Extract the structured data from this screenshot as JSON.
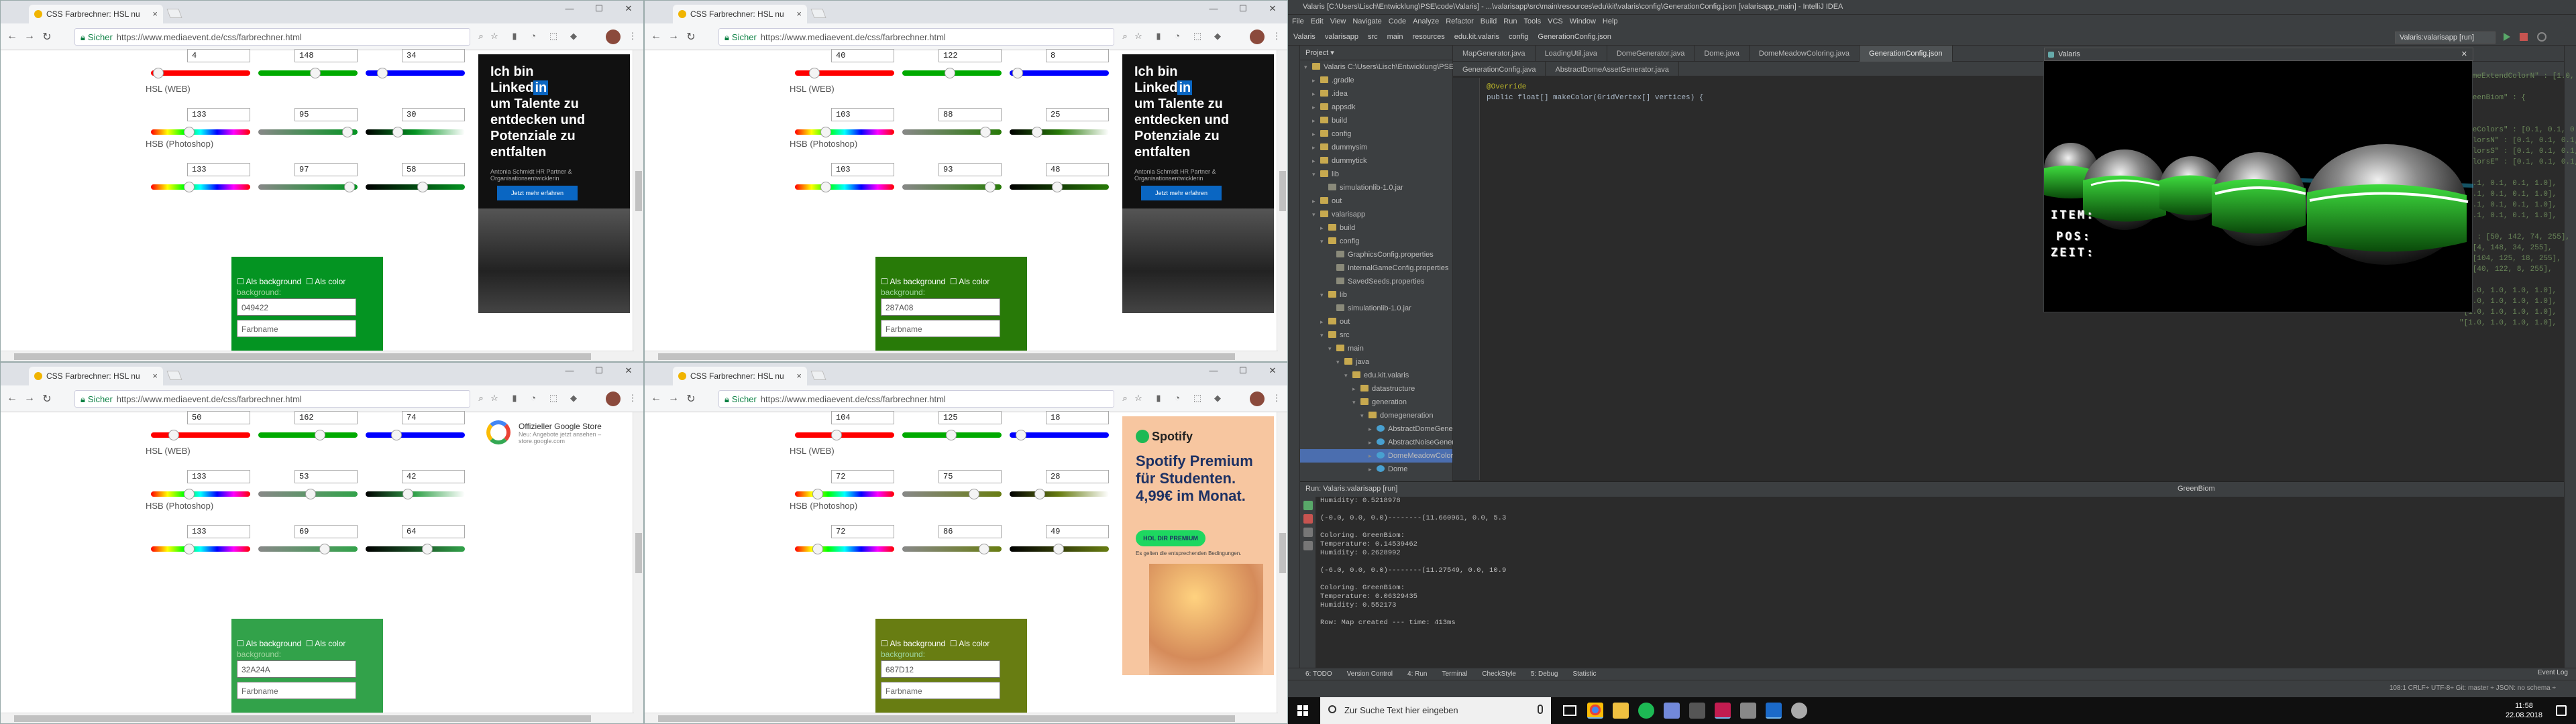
{
  "browser": {
    "tab_title": "CSS Farbrechner: HSL nu",
    "secure_label": "Sicher",
    "url": "https://www.mediaevent.de/css/farbrechner.html",
    "close_tab": "×",
    "win_min": "—",
    "win_max": "☐",
    "win_close": "✕"
  },
  "labels": {
    "hsl": "HSL (WEB)",
    "hsb": "HSB (Photoshop)",
    "as_background": "Als background",
    "as_color": "Als color",
    "background_hint": "background:",
    "colorname_placeholder": "Farbname"
  },
  "panels": [
    {
      "rgb": [
        "4",
        "148",
        "34"
      ],
      "hsl": [
        "133",
        "95",
        "30"
      ],
      "hsb": [
        "133",
        "97",
        "58"
      ],
      "hex": "049422",
      "box_color": "#049422",
      "rgb_pos": [
        0.02,
        0.58,
        0.13
      ],
      "hsl_pos": [
        0.37,
        0.95,
        0.3
      ],
      "hsb_pos": [
        0.37,
        0.97,
        0.58
      ],
      "ad": "linkedin"
    },
    {
      "rgb": [
        "40",
        "122",
        "8"
      ],
      "hsl": [
        "103",
        "88",
        "25"
      ],
      "hsb": [
        "103",
        "93",
        "48"
      ],
      "hex": "287A08",
      "box_color": "#287a08",
      "rgb_pos": [
        0.16,
        0.48,
        0.03
      ],
      "hsl_pos": [
        0.29,
        0.88,
        0.25
      ],
      "hsb_pos": [
        0.29,
        0.93,
        0.48
      ],
      "ad": "linkedin"
    },
    {
      "rgb": [
        "50",
        "162",
        "74"
      ],
      "hsl": [
        "133",
        "53",
        "42"
      ],
      "hsb": [
        "133",
        "69",
        "64"
      ],
      "hex": "32A24A",
      "box_color": "#32a24a",
      "rgb_pos": [
        0.2,
        0.64,
        0.29
      ],
      "hsl_pos": [
        0.37,
        0.53,
        0.42
      ],
      "hsb_pos": [
        0.37,
        0.69,
        0.64
      ],
      "ad": "google"
    },
    {
      "rgb": [
        "104",
        "125",
        "18"
      ],
      "hsl": [
        "72",
        "75",
        "28"
      ],
      "hsb": [
        "72",
        "86",
        "49"
      ],
      "hex": "687D12",
      "box_color": "#687d12",
      "rgb_pos": [
        0.41,
        0.49,
        0.07
      ],
      "hsl_pos": [
        0.2,
        0.75,
        0.28
      ],
      "hsb_pos": [
        0.2,
        0.86,
        0.49
      ],
      "ad": "spotify"
    }
  ],
  "ads": {
    "linkedin": {
      "headline_1": "Ich bin",
      "headline_2": "Linked",
      "headline_in": "in",
      "headline_3": "um Talente zu entdecken und Potenziale zu entfalten",
      "sub": "Antonia Schmidt HR Partner & Organisationsentwicklerin",
      "button": "Jetzt mehr erfahren"
    },
    "google": {
      "title": "Offizieller Google Store",
      "sub": "Neu: Angebote jetzt ansehen – store.google.com"
    },
    "spotify": {
      "logo": "Spotify",
      "headline": "Spotify Premium für Studenten. 4,99€ im Monat.",
      "button": "HOL DIR PREMIUM",
      "sub": "Es gelten die entsprechenden Bedingungen."
    }
  },
  "ide": {
    "title": "Valaris [C:\\Users\\Lisch\\Entwicklung\\PSE\\code\\Valaris] - ...\\valarisapp\\src\\main\\resources\\edu\\kit\\valaris\\config\\GenerationConfig.json [valarisapp_main] - IntelliJ IDEA",
    "menu": [
      "File",
      "Edit",
      "View",
      "Navigate",
      "Code",
      "Analyze",
      "Refactor",
      "Build",
      "Run",
      "Tools",
      "VCS",
      "Window",
      "Help"
    ],
    "breadcrumb": [
      "Valaris",
      "valarisapp",
      "src",
      "main",
      "resources",
      "edu.kit.valaris",
      "config",
      "GenerationConfig.json"
    ],
    "run_config": "Valaris:valarisapp [run]",
    "editor_tabs": [
      "MapGenerator.java",
      "LoadingUtil.java",
      "DomeGenerator.java",
      "Dome.java",
      "DomeMeadowColoring.java",
      "GenerationConfig.json"
    ],
    "editor_tabs2": [
      "GenerationConfig.java",
      "AbstractDomeAssetGenerator.java"
    ],
    "code_left": [
      "@Override",
      "public float[] makeColor(GridVertex[] vertices) {"
    ],
    "code_right": [
      "\"DomeExtendColorN\" : [1.0, 1.0, 1.0, 1.0]",
      "",
      "\"GreenBiom\" : {",
      "",
      "",
      "\"omeColors\" : [0.1, 0.1, 0.1, 1.0],",
      "\"ColorsN\" : [0.1, 0.1, 0.1, 1.0],",
      "\"ColorsS\" : [0.1, 0.1, 0.1, 1.0],",
      "\"ColorsE\" : [0.1, 0.1, 0.1, 1.0],",
      "",
      "\"[0.1, 0.1, 0.1, 1.0],",
      "\"[0.1, 0.1, 0.1, 1.0],",
      "\"[0.1, 0.1, 0.1, 1.0],",
      "\"[0.1, 0.1, 0.1, 1.0],",
      "",
      "\"E\" : [50, 142, 74, 255],",
      "\": [4, 148, 34, 255],",
      "\": [104, 125, 18, 255],",
      "\": [40, 122, 8, 255],",
      "",
      "\"[1.0, 1.0, 1.0, 1.0],",
      "\"[1.0, 1.0, 1.0, 1.0],",
      "\"[1.0, 1.0, 1.0, 1.0],",
      "\"[1.0, 1.0, 1.0, 1.0],"
    ],
    "project_label": "Project",
    "project_tree": [
      {
        "d": 0,
        "t": "Valaris C:\\Users\\Lisch\\Entwicklung\\PSE\\code\\Valaris",
        "ic": "f",
        "tw": "▾"
      },
      {
        "d": 1,
        "t": ".gradle",
        "ic": "f",
        "tw": "▸"
      },
      {
        "d": 1,
        "t": ".idea",
        "ic": "f",
        "tw": "▸"
      },
      {
        "d": 1,
        "t": "appsdk",
        "ic": "f",
        "tw": "▸"
      },
      {
        "d": 1,
        "t": "build",
        "ic": "f",
        "tw": "▸"
      },
      {
        "d": 1,
        "t": "config",
        "ic": "f",
        "tw": "▸"
      },
      {
        "d": 1,
        "t": "dummysim",
        "ic": "f",
        "tw": "▸"
      },
      {
        "d": 1,
        "t": "dummytick",
        "ic": "f",
        "tw": "▸"
      },
      {
        "d": 1,
        "t": "lib",
        "ic": "f",
        "tw": "▾"
      },
      {
        "d": 2,
        "t": "simulationlib-1.0.jar",
        "ic": "n",
        "tw": ""
      },
      {
        "d": 1,
        "t": "out",
        "ic": "f",
        "tw": "▸"
      },
      {
        "d": 1,
        "t": "valarisapp",
        "ic": "f",
        "tw": "▾"
      },
      {
        "d": 2,
        "t": "build",
        "ic": "f",
        "tw": "▸"
      },
      {
        "d": 2,
        "t": "config",
        "ic": "f",
        "tw": "▾"
      },
      {
        "d": 3,
        "t": "GraphicsConfig.properties",
        "ic": "n",
        "tw": ""
      },
      {
        "d": 3,
        "t": "InternalGameConfig.properties",
        "ic": "n",
        "tw": ""
      },
      {
        "d": 3,
        "t": "SavedSeeds.properties",
        "ic": "n",
        "tw": ""
      },
      {
        "d": 2,
        "t": "lib",
        "ic": "f",
        "tw": "▾"
      },
      {
        "d": 3,
        "t": "simulationlib-1.0.jar",
        "ic": "n",
        "tw": ""
      },
      {
        "d": 2,
        "t": "out",
        "ic": "f",
        "tw": "▸"
      },
      {
        "d": 2,
        "t": "src",
        "ic": "f",
        "tw": "▾"
      },
      {
        "d": 3,
        "t": "main",
        "ic": "f",
        "tw": "▾"
      },
      {
        "d": 4,
        "t": "java",
        "ic": "f",
        "tw": "▾"
      },
      {
        "d": 5,
        "t": "edu.kit.valaris",
        "ic": "f",
        "tw": "▾"
      },
      {
        "d": 6,
        "t": "datastructure",
        "ic": "f",
        "tw": "▸"
      },
      {
        "d": 6,
        "t": "generation",
        "ic": "f",
        "tw": "▾"
      },
      {
        "d": 7,
        "t": "domegeneration",
        "ic": "f",
        "tw": "▾"
      },
      {
        "d": 8,
        "t": "AbstractDomeGenerator",
        "ic": "c",
        "tw": "▸"
      },
      {
        "d": 8,
        "t": "AbstractNoiseGenerator",
        "ic": "c",
        "tw": "▸"
      },
      {
        "d": 8,
        "t": "DomeMeadowColoring",
        "ic": "c",
        "tw": "▸"
      },
      {
        "d": 8,
        "t": "Dome",
        "ic": "c",
        "tw": "▸"
      }
    ],
    "hud": [
      "ITEM:",
      "POS:",
      "ZEIT:"
    ],
    "game_window_title": "Valaris",
    "run_header": "Run:  Valaris:valarisapp [run]",
    "console": "Humidity: 0.5218978\n\n(-0.0, 0.0, 0.0)--------(11.660961, 0.0, 5.3\n\nColoring. GreenBiom:\nTemperature: 0.14539462\nHumidity: 0.2628992\n\n(-6.0, 0.0, 0.0)--------(11.27549, 0.0, 10.9\n\nColoring. GreenBiom:\nTemperature: 0.06329435\nHumidity: 0.552173\n\nRow: Map created --- time: 413ms",
    "bottom_tabs": [
      "6: TODO",
      "Version Control",
      "4: Run",
      "Terminal",
      "CheckStyle",
      "5: Debug",
      "Statistic"
    ],
    "status_left": "",
    "status_right": "108:1   CRLF÷   UTF-8÷   Git: master ÷   JSON: no schema ÷",
    "event_log": "Event Log",
    "breadcrumb_right": "GreenBiom"
  },
  "taskbar": {
    "search_placeholder": "Zur Suche Text hier eingeben",
    "time": "11:58",
    "date": "22.08.2018"
  }
}
